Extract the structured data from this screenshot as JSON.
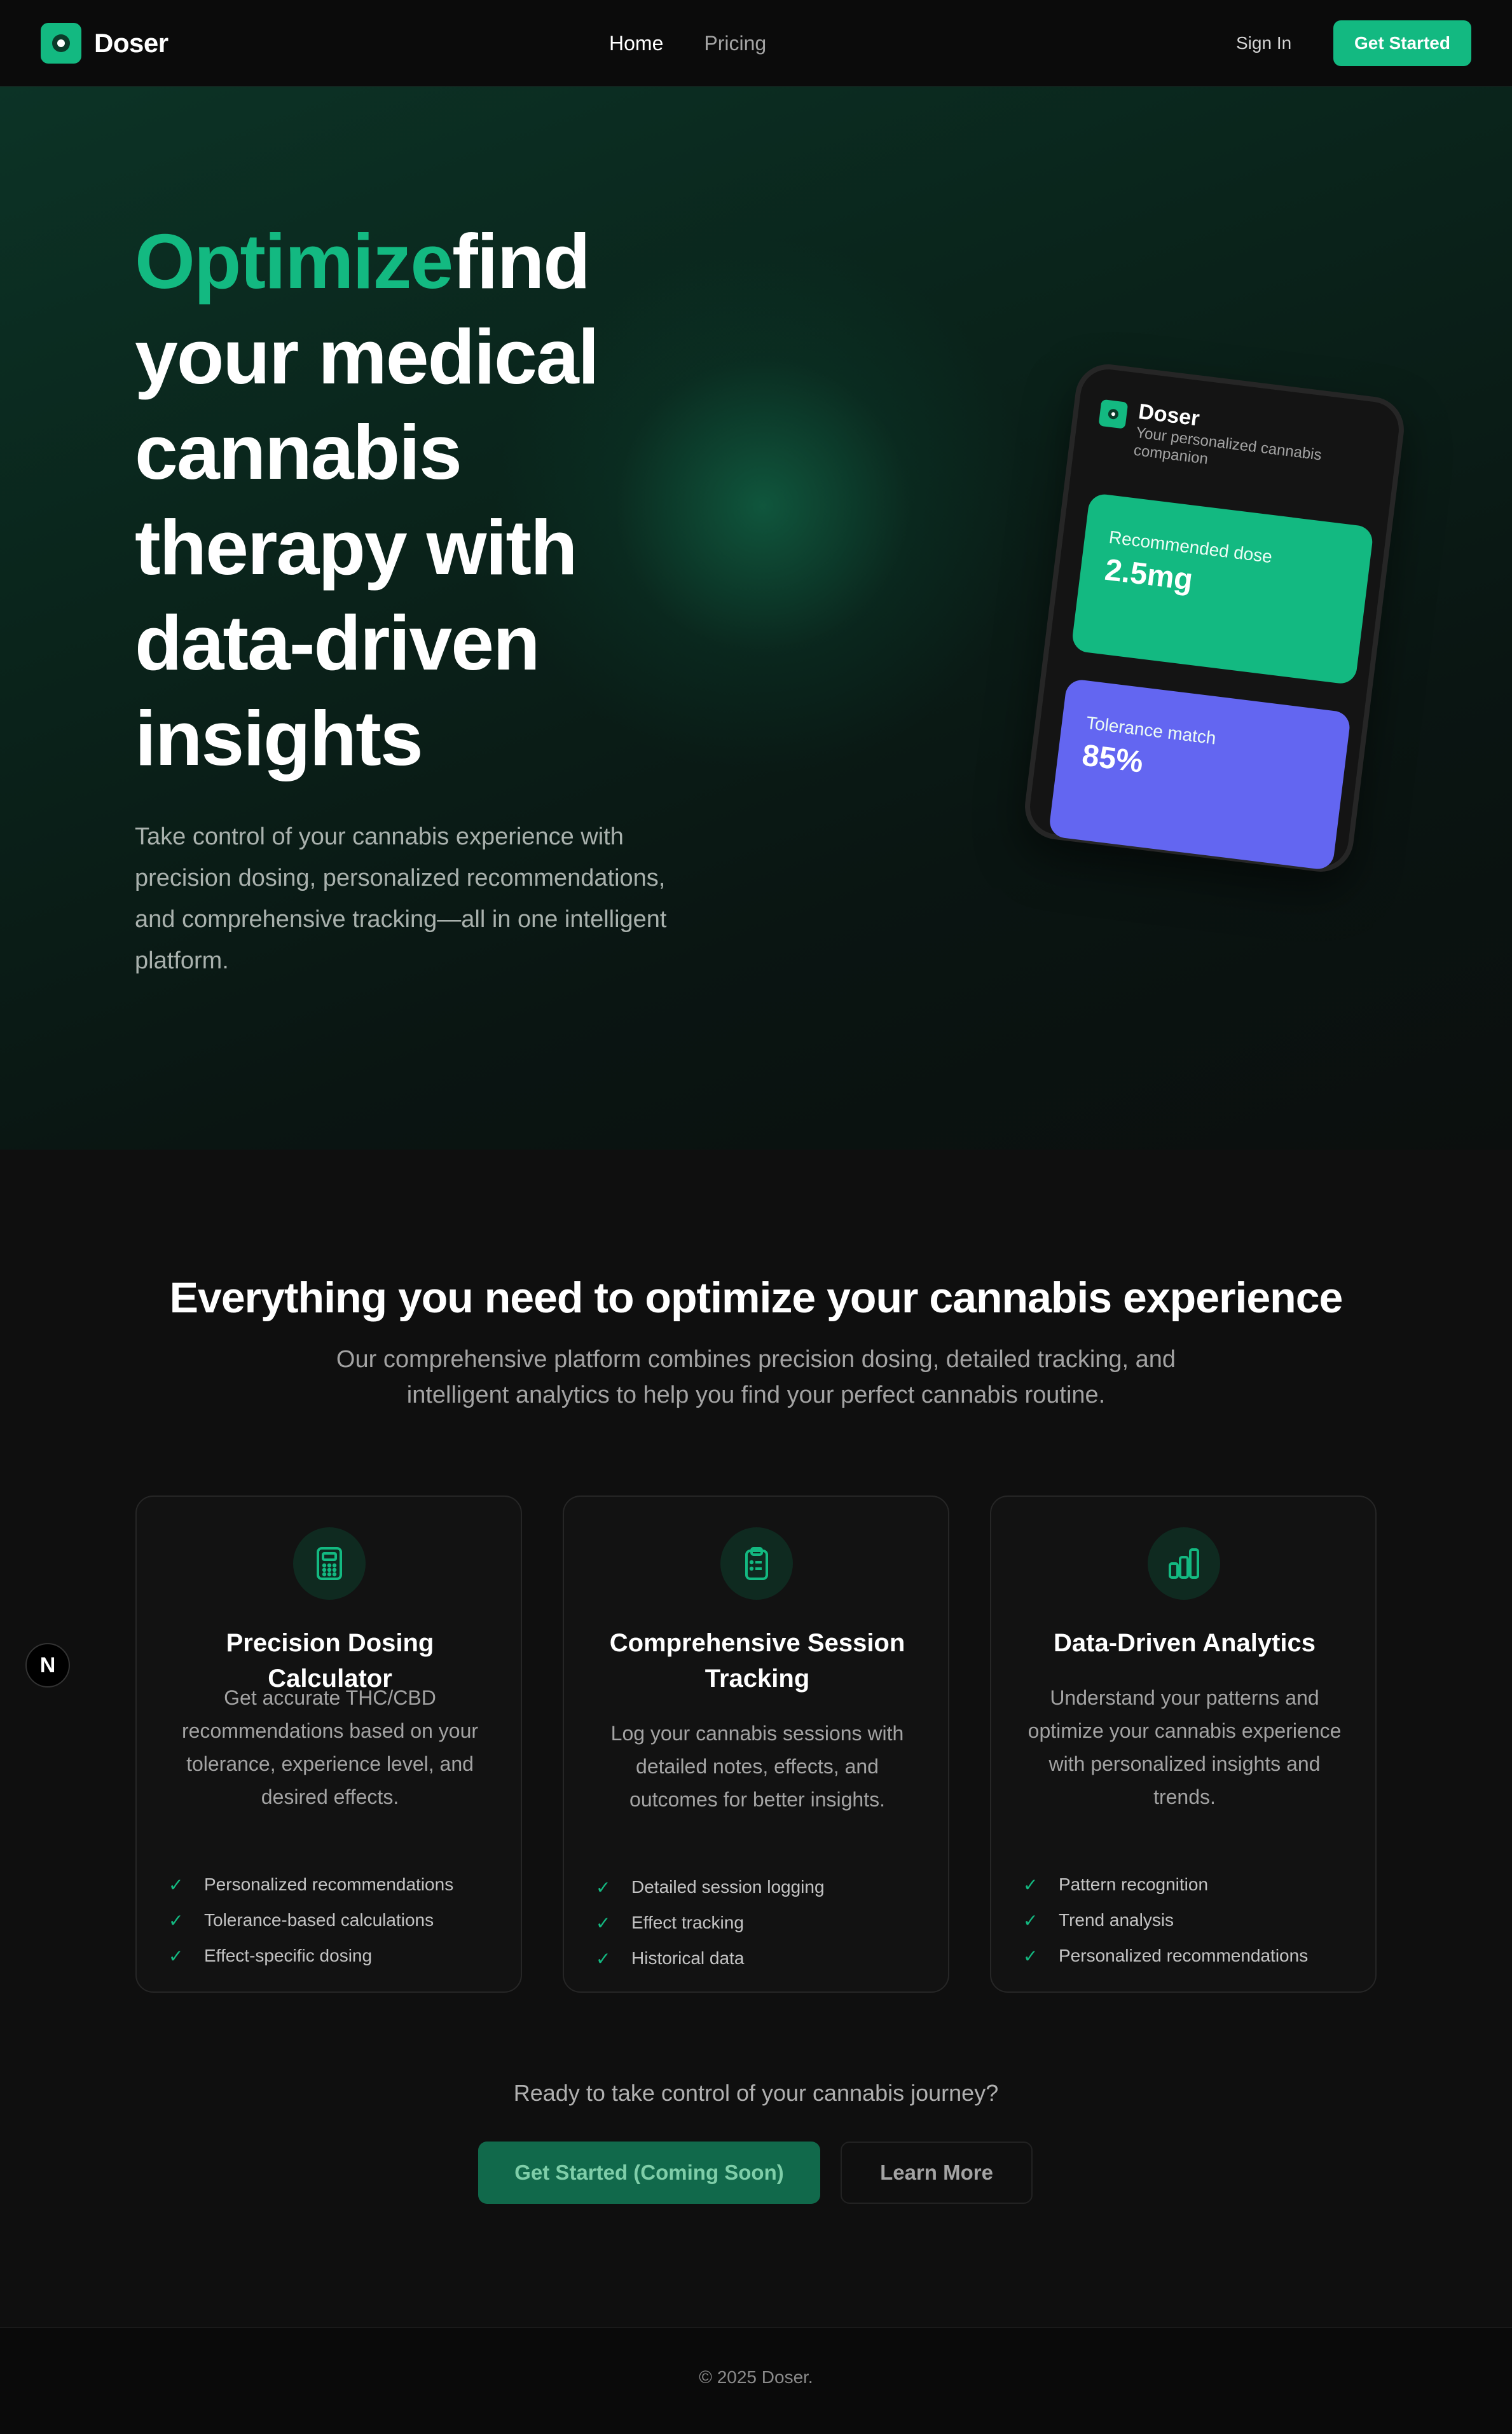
{
  "brand": {
    "name": "Doser"
  },
  "nav": {
    "links": [
      {
        "label": "Home",
        "active": true
      },
      {
        "label": "Pricing",
        "active": false
      }
    ],
    "sign_in": "Sign In",
    "cta": "Get Started"
  },
  "hero": {
    "title_accent": "Optimize",
    "title_rest": "find your medical cannabis therapy with data-driven insights",
    "subtitle": "Take control of your cannabis experience with precision dosing, personalized recommendations, and comprehensive tracking—all in one intelligent platform."
  },
  "phone": {
    "app_name": "Doser",
    "tagline": "Your personalized cannabis companion",
    "cards": [
      {
        "label": "Recommended dose",
        "value": "2.5mg",
        "color": "#13b981"
      },
      {
        "label": "Tolerance match",
        "value": "85%",
        "color": "#6366f1"
      }
    ]
  },
  "features": {
    "title": "Everything you need to optimize your cannabis experience",
    "subtitle": "Our comprehensive platform combines precision dosing, detailed tracking, and intelligent analytics to help you find your perfect cannabis routine.",
    "cards": [
      {
        "icon": "calculator-icon",
        "title": "Precision Dosing Calculator",
        "description": "Get accurate THC/CBD recommendations based on your tolerance, experience level, and desired effects.",
        "items": [
          "Personalized recommendations",
          "Tolerance-based calculations",
          "Effect-specific dosing"
        ]
      },
      {
        "icon": "clipboard-list-icon",
        "title": "Comprehensive Session Tracking",
        "description": "Log your cannabis sessions with detailed notes, effects, and outcomes for better insights.",
        "items": [
          "Detailed session logging",
          "Effect tracking",
          "Historical data"
        ]
      },
      {
        "icon": "bar-chart-icon",
        "title": "Data-Driven Analytics",
        "description": "Understand your patterns and optimize your cannabis experience with personalized insights and trends.",
        "items": [
          "Pattern recognition",
          "Trend analysis",
          "Personalized recommendations"
        ]
      }
    ]
  },
  "cta": {
    "text": "Ready to take control of your cannabis journey?",
    "primary": "Get Started (Coming Soon)",
    "secondary": "Learn More"
  },
  "badge": {
    "letter": "N"
  },
  "footer": {
    "copyright": "© 2025 Doser."
  },
  "colors": {
    "accent": "#13b981",
    "indigo": "#6366f1",
    "background": "#0f0f0f"
  }
}
